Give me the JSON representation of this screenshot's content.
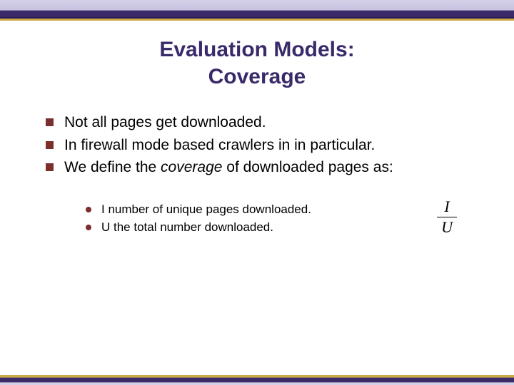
{
  "title": {
    "line1": "Evaluation Models:",
    "line2": "Coverage"
  },
  "bullets": [
    "Not all pages get downloaded.",
    "In firewall mode based crawlers in in particular.",
    {
      "pre": "We define the ",
      "em": "coverage",
      "post": " of downloaded pages as:"
    }
  ],
  "sub_bullets": [
    "I  number of unique pages downloaded.",
    "U  the total number downloaded."
  ],
  "fraction": {
    "numerator": "I",
    "denominator": "U"
  }
}
